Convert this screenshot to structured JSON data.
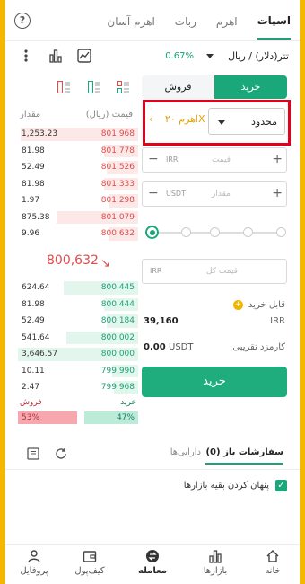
{
  "top_tabs": [
    "اسپات",
    "اهرم",
    "ربات",
    "اهرم آسان"
  ],
  "help_label": "?",
  "market": {
    "pair": "تتر(دلار) / ریال",
    "change": "0.67%"
  },
  "orderbook": {
    "header_price": "قیمت (ریال)",
    "header_amount": "مقدار",
    "asks": [
      {
        "price": "801.968",
        "amount": "1,253.23",
        "depth": 0.98
      },
      {
        "price": "801.778",
        "amount": "81.98",
        "depth": 0.28
      },
      {
        "price": "801.526",
        "amount": "52.49",
        "depth": 0.26
      },
      {
        "price": "801.333",
        "amount": "81.98",
        "depth": 0.28
      },
      {
        "price": "801.298",
        "amount": "1.97",
        "depth": 0.24
      },
      {
        "price": "801.079",
        "amount": "875.38",
        "depth": 0.68
      },
      {
        "price": "800.632",
        "amount": "9.96",
        "depth": 0.25
      }
    ],
    "last_price": "800,632",
    "last_arrow": "↘",
    "bids": [
      {
        "price": "800.445",
        "amount": "624.64",
        "depth": 0.62
      },
      {
        "price": "800.444",
        "amount": "81.98",
        "depth": 0.28
      },
      {
        "price": "800.184",
        "amount": "52.49",
        "depth": 0.26
      },
      {
        "price": "800.002",
        "amount": "541.64",
        "depth": 0.6
      },
      {
        "price": "800.000",
        "amount": "3,646.57",
        "depth": 1.0
      },
      {
        "price": "799.990",
        "amount": "10.11",
        "depth": 0.22
      },
      {
        "price": "799.968",
        "amount": "2.47",
        "depth": 0.2
      }
    ],
    "sell_label": "فروش",
    "buy_label": "خرید",
    "sell_ratio": "53%",
    "buy_ratio": "47%"
  },
  "form": {
    "buy_tab": "خرید",
    "sell_tab": "فروش",
    "order_type": "محدود",
    "leverage": "اهرم ۲۰X",
    "leverage_arrow": "‹",
    "price_placeholder": "قیمت",
    "price_currency": "IRR",
    "amount_placeholder": "مقدار",
    "amount_currency": "USDT",
    "total_placeholder": "قیمت کل",
    "total_currency": "IRR",
    "available_label": "قابل خرید",
    "available_value": "39,160",
    "available_currency": "IRR",
    "fee_label": "کارمزد تقریبی",
    "fee_value": "0.00",
    "fee_currency": "USDT",
    "submit": "خرید"
  },
  "orders": {
    "open_tab": "سفارشات باز (0)",
    "assets_tab": "دارایی‌ها",
    "hide_others": "پنهان کردن بقیه بازارها"
  },
  "nav": [
    "خانه",
    "بازارها",
    "معامله",
    "کیف‌پول",
    "پروفایل"
  ]
}
